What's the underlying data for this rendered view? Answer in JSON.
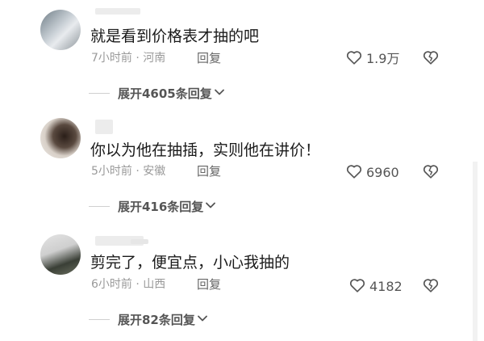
{
  "comments": [
    {
      "text": "就是看到价格表才抽的吧",
      "time": "7小时前",
      "location": "河南",
      "reply_label": "回复",
      "likes": "1.9万",
      "expand_label": "展开4605条回复"
    },
    {
      "text": "你以为他在抽插，实则他在讲价！",
      "time": "5小时前",
      "location": "安徽",
      "reply_label": "回复",
      "likes": "6960",
      "expand_label": "展开416条回复"
    },
    {
      "text": "剪完了，便宜点，小心我抽的",
      "time": "6小时前",
      "location": "山西",
      "reply_label": "回复",
      "likes": "4182",
      "expand_label": "展开82条回复"
    }
  ],
  "separator": "·",
  "icons": {
    "like": "heart-outline-icon",
    "dislike": "broken-heart-icon",
    "expand": "chevron-down-icon"
  },
  "colors": {
    "text": "#1a1a1a",
    "meta": "#9a9a9a",
    "icon": "#555555"
  }
}
